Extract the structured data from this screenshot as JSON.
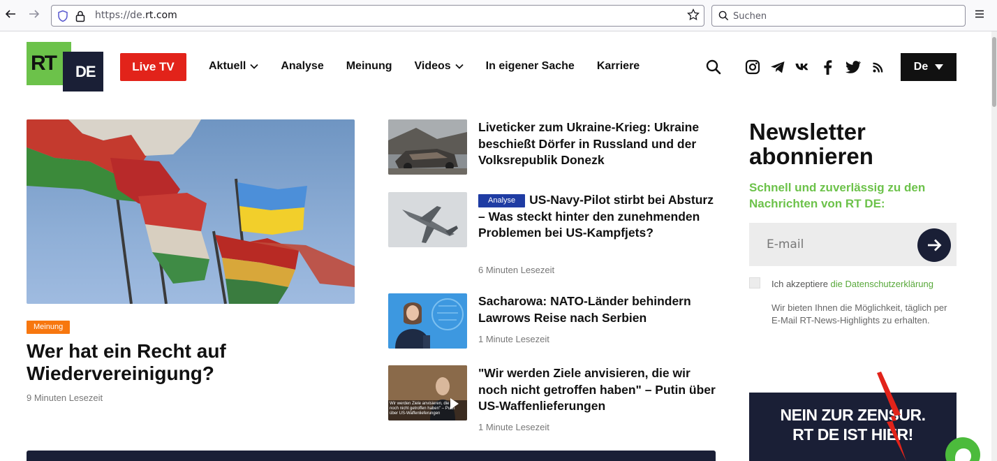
{
  "browser": {
    "url_prefix": "https://de.",
    "url_host": "rt.com",
    "search_placeholder": "Suchen"
  },
  "header": {
    "logo_left": "RT",
    "logo_right": "DE",
    "live_button": "Live TV",
    "nav": [
      {
        "label": "Aktuell",
        "dropdown": true
      },
      {
        "label": "Analyse",
        "dropdown": false
      },
      {
        "label": "Meinung",
        "dropdown": false
      },
      {
        "label": "Videos",
        "dropdown": true
      },
      {
        "label": "In eigener Sache",
        "dropdown": false
      },
      {
        "label": "Karriere",
        "dropdown": false
      }
    ],
    "language": "De",
    "social_icons": [
      "instagram-icon",
      "telegram-icon",
      "vk-icon",
      "facebook-icon",
      "twitter-icon",
      "rss-icon"
    ]
  },
  "lead": {
    "tag": "Meinung",
    "title": "Wer hat ein Recht auf Wiedervereinigung?",
    "reading_time": "9 Minuten Lesezeit"
  },
  "articles": [
    {
      "title": "Liveticker zum Ukraine-Krieg: Ukraine beschießt Dörfer in Russland und der Volksrepublik Donezk",
      "tag": "",
      "reading_time": ""
    },
    {
      "title": "US-Navy-Pilot stirbt bei Absturz – Was steckt hinter den zunehmenden Problemen bei US-Kampfjets?",
      "tag": "Analyse",
      "reading_time": "6 Minuten Lesezeit"
    },
    {
      "title": "Sacharowa: NATO-Länder behindern Lawrows Reise nach Serbien",
      "tag": "",
      "reading_time": "1 Minute Lesezeit"
    },
    {
      "title": "\"Wir werden Ziele anvisieren, die wir noch nicht getroffen haben\" – Putin über US-Waffenlieferungen",
      "tag": "",
      "reading_time": "1 Minute Lesezeit"
    }
  ],
  "video_thumb_caption": "Wir werden Ziele anvisieren, die wir noch nicht getroffen haben\" – Putin über US-Waffenlieferungen",
  "newsletter": {
    "title": "Newsletter abonnieren",
    "subtitle": "Schnell und zuverlässig zu den Nachrichten von RT DE:",
    "email_placeholder": "E-mail",
    "accept_prefix": "Ich akzeptiere ",
    "accept_link": "die Datenschutzerklärung",
    "info": "Wir bieten Ihnen die Möglichkeit, täglich per E-Mail RT-News-Highlights zu erhalten."
  },
  "banner": {
    "line1": "NEIN ZUR ZENSUR.",
    "line2": "RT DE IST HIER!"
  },
  "colors": {
    "brand_green": "#6cc24a",
    "live_red": "#e2231a",
    "navy": "#1a1f36",
    "meinung_orange": "#f7770f",
    "analyse_blue": "#1f3ca3"
  }
}
